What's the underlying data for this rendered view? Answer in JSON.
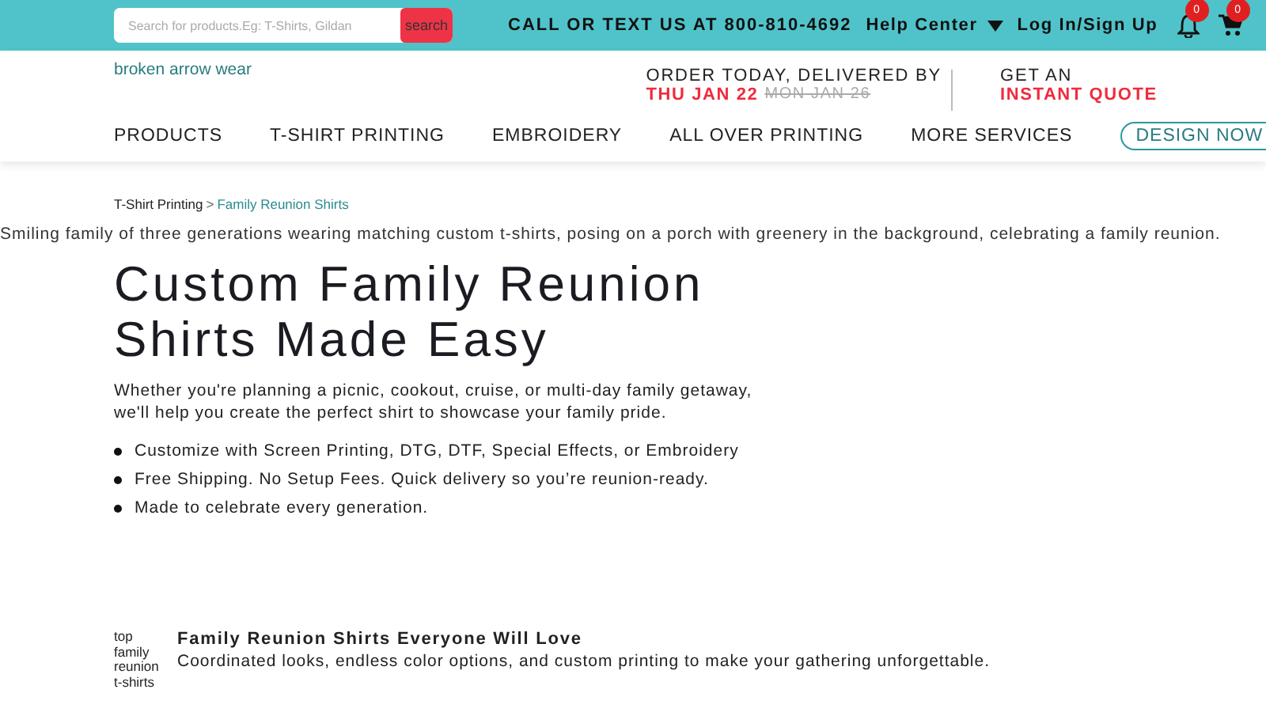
{
  "topbar": {
    "search": {
      "placeholder": "Search for products.Eg: T-Shirts, Gildan",
      "button": "search"
    },
    "call": "CALL OR TEXT US AT 800-810-4692",
    "help": "Help Center",
    "login": "Log In/Sign Up",
    "notifications": "0",
    "cart": "0"
  },
  "header": {
    "logo_alt": "broken arrow wear",
    "delivery": {
      "label": "ORDER TODAY, DELIVERED BY",
      "date": "THU JAN 22",
      "old_date": "MON JAN 26"
    },
    "quote": {
      "label": "GET AN",
      "action": "INSTANT QUOTE"
    }
  },
  "nav": {
    "items": [
      "PRODUCTS",
      "T-SHIRT PRINTING",
      "EMBROIDERY",
      "ALL OVER PRINTING",
      "MORE SERVICES"
    ],
    "cta": "DESIGN NOW"
  },
  "breadcrumb_separator": ">",
  "breadcrumb": [
    {
      "label": "T-Shirt Printing",
      "selected": false
    },
    {
      "label": "Family Reunion Shirts",
      "selected": true
    }
  ],
  "hero_alt": "Smiling family of three generations wearing matching custom t-shirts, posing on a porch with greenery in the background, celebrating a family reunion.",
  "title": "Custom Family Reunion Shirts Made Easy",
  "intro": "Whether you're planning a picnic, cookout, cruise, or multi-day family getaway, we'll help you create the perfect shirt to showcase your family pride.",
  "bullets": [
    "Customize with Screen Printing, DTG, DTF, Special Effects, or Embroidery",
    "Free Shipping. No Setup Fees. Quick delivery so you’re reunion-ready.",
    "Made to celebrate every generation."
  ],
  "feature": {
    "image_alt": "top family reunion t-shirts",
    "heading": "Family Reunion Shirts Everyone Will Love",
    "text": "Coordinated looks, endless color options, and custom printing to make your gathering unforgettable."
  }
}
